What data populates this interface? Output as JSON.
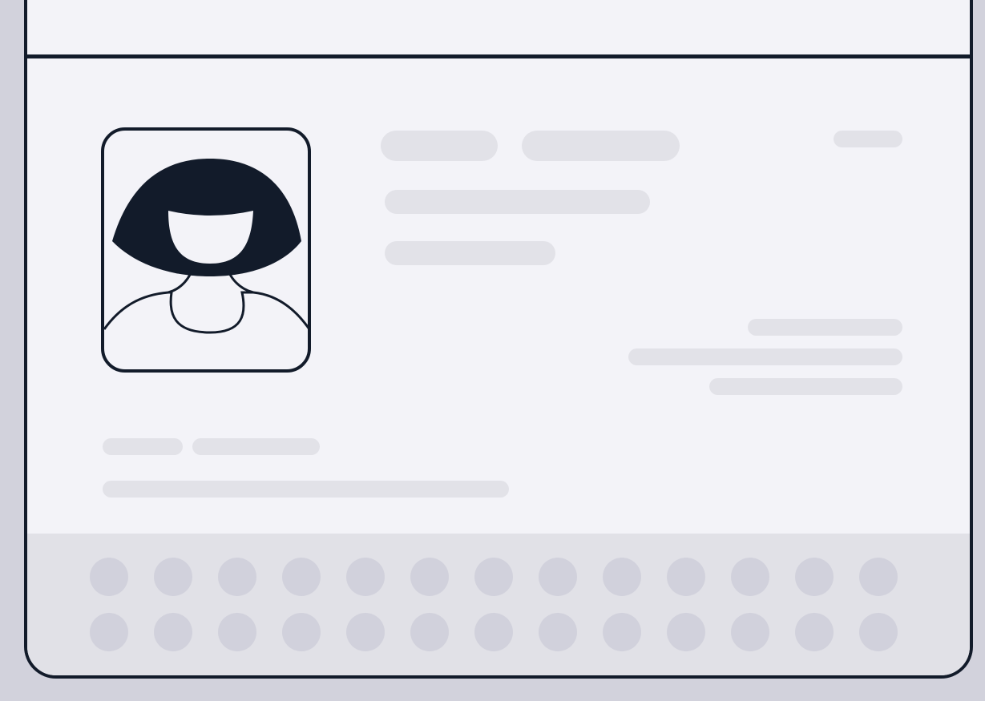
{
  "card": {
    "photo_icon": "person-portrait-icon",
    "colors": {
      "outline": "#121b2a",
      "card_bg": "#f3f3f8",
      "placeholder": "#e2e2e8",
      "dot": "#d1d1dc",
      "frame": "#d2d2dc"
    }
  },
  "dots": {
    "rows": 2,
    "columns": 13
  }
}
